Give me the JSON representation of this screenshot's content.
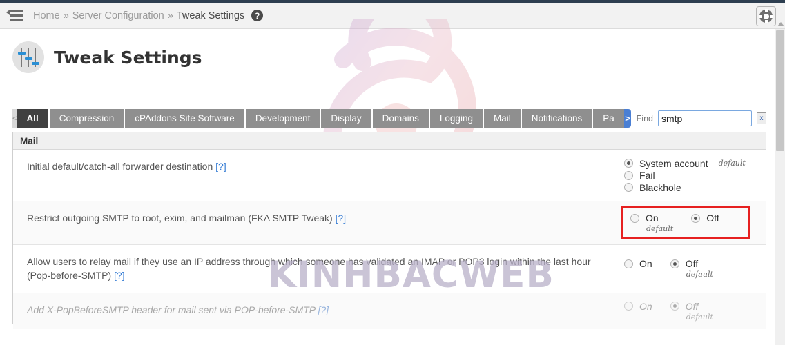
{
  "header": {
    "menu_icon": "hamburger-collapse-icon",
    "breadcrumb": {
      "home": "Home",
      "sep1": "»",
      "section": "Server Configuration",
      "sep2": "»",
      "current": "Tweak Settings",
      "help_glyph": "?"
    },
    "support_icon": "lifesaver-icon"
  },
  "page": {
    "title": "Tweak Settings",
    "title_icon": "sliders-icon"
  },
  "watermarks": {
    "logo": "swirl-logo-watermark",
    "text": "KINHBACWEB"
  },
  "tabs": {
    "prev_glyph": "<",
    "next_glyph": ">",
    "items": [
      {
        "label": "All",
        "active": true
      },
      {
        "label": "Compression",
        "active": false
      },
      {
        "label": "cPAddons Site Software",
        "active": false
      },
      {
        "label": "Development",
        "active": false
      },
      {
        "label": "Display",
        "active": false
      },
      {
        "label": "Domains",
        "active": false
      },
      {
        "label": "Logging",
        "active": false
      },
      {
        "label": "Mail",
        "active": false
      },
      {
        "label": "Notifications",
        "active": false
      },
      {
        "label": "Pa",
        "active": false
      }
    ]
  },
  "find": {
    "label": "Find",
    "value": "smtp",
    "placeholder": "",
    "clear_glyph": "x"
  },
  "table": {
    "group_header": "Mail",
    "rows": [
      {
        "label": "Initial default/catch-all forwarder destination",
        "help": "[?]",
        "disabled": false,
        "layout": "stack",
        "options": [
          {
            "text": "System account",
            "checked": true,
            "default_tag": "default",
            "default_pos": "inline"
          },
          {
            "text": "Fail",
            "checked": false,
            "default_tag": "",
            "default_pos": "none"
          },
          {
            "text": "Blackhole",
            "checked": false,
            "default_tag": "",
            "default_pos": "none"
          }
        ]
      },
      {
        "label": "Restrict outgoing SMTP to root, exim, and mailman (FKA SMTP Tweak)",
        "help": "[?]",
        "disabled": false,
        "layout": "inline",
        "highlighted": true,
        "options": [
          {
            "text": "On",
            "checked": false,
            "default_tag": "default",
            "default_pos": "under"
          },
          {
            "text": "Off",
            "checked": true,
            "default_tag": "",
            "default_pos": "none"
          }
        ]
      },
      {
        "label": "Allow users to relay mail if they use an IP address through which someone has validated an IMAP or POP3 login within the last hour (Pop-before-SMTP)",
        "help": "[?]",
        "disabled": false,
        "layout": "inline",
        "highlighted": false,
        "options": [
          {
            "text": "On",
            "checked": false,
            "default_tag": "",
            "default_pos": "none"
          },
          {
            "text": "Off",
            "checked": true,
            "default_tag": "default",
            "default_pos": "under"
          }
        ]
      },
      {
        "label": "Add X-PopBeforeSMTP header for mail sent via POP-before-SMTP",
        "help": "[?]",
        "disabled": true,
        "layout": "inline",
        "highlighted": false,
        "options": [
          {
            "text": "On",
            "checked": false,
            "default_tag": "",
            "default_pos": "none"
          },
          {
            "text": "Off",
            "checked": true,
            "default_tag": "default",
            "default_pos": "under"
          }
        ]
      }
    ]
  },
  "colors": {
    "accent_blue": "#3a7fd5",
    "tab_active": "#404040",
    "tab_inactive": "#8f8f8f",
    "highlight_red": "#e62020",
    "top_strip": "#2d3e50"
  }
}
